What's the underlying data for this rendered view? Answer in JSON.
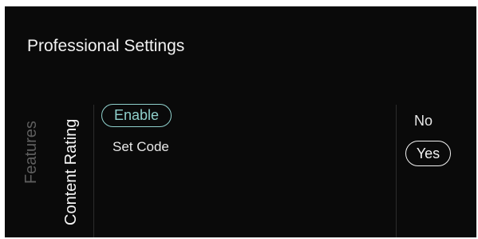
{
  "header": {
    "title": "Professional Settings"
  },
  "categories": {
    "features_label": "Features",
    "content_rating_label": "Content Rating"
  },
  "content_rating_menu": {
    "enable_label": "Enable",
    "set_code_label": "Set Code"
  },
  "value_options": {
    "no_label": "No",
    "yes_label": "Yes",
    "selected": "Yes"
  },
  "colors": {
    "background": "#0a0a0a",
    "accent_teal": "#8fd0cc",
    "text_primary": "#f2f2f2",
    "text_dimmed": "#5e5e5e"
  }
}
